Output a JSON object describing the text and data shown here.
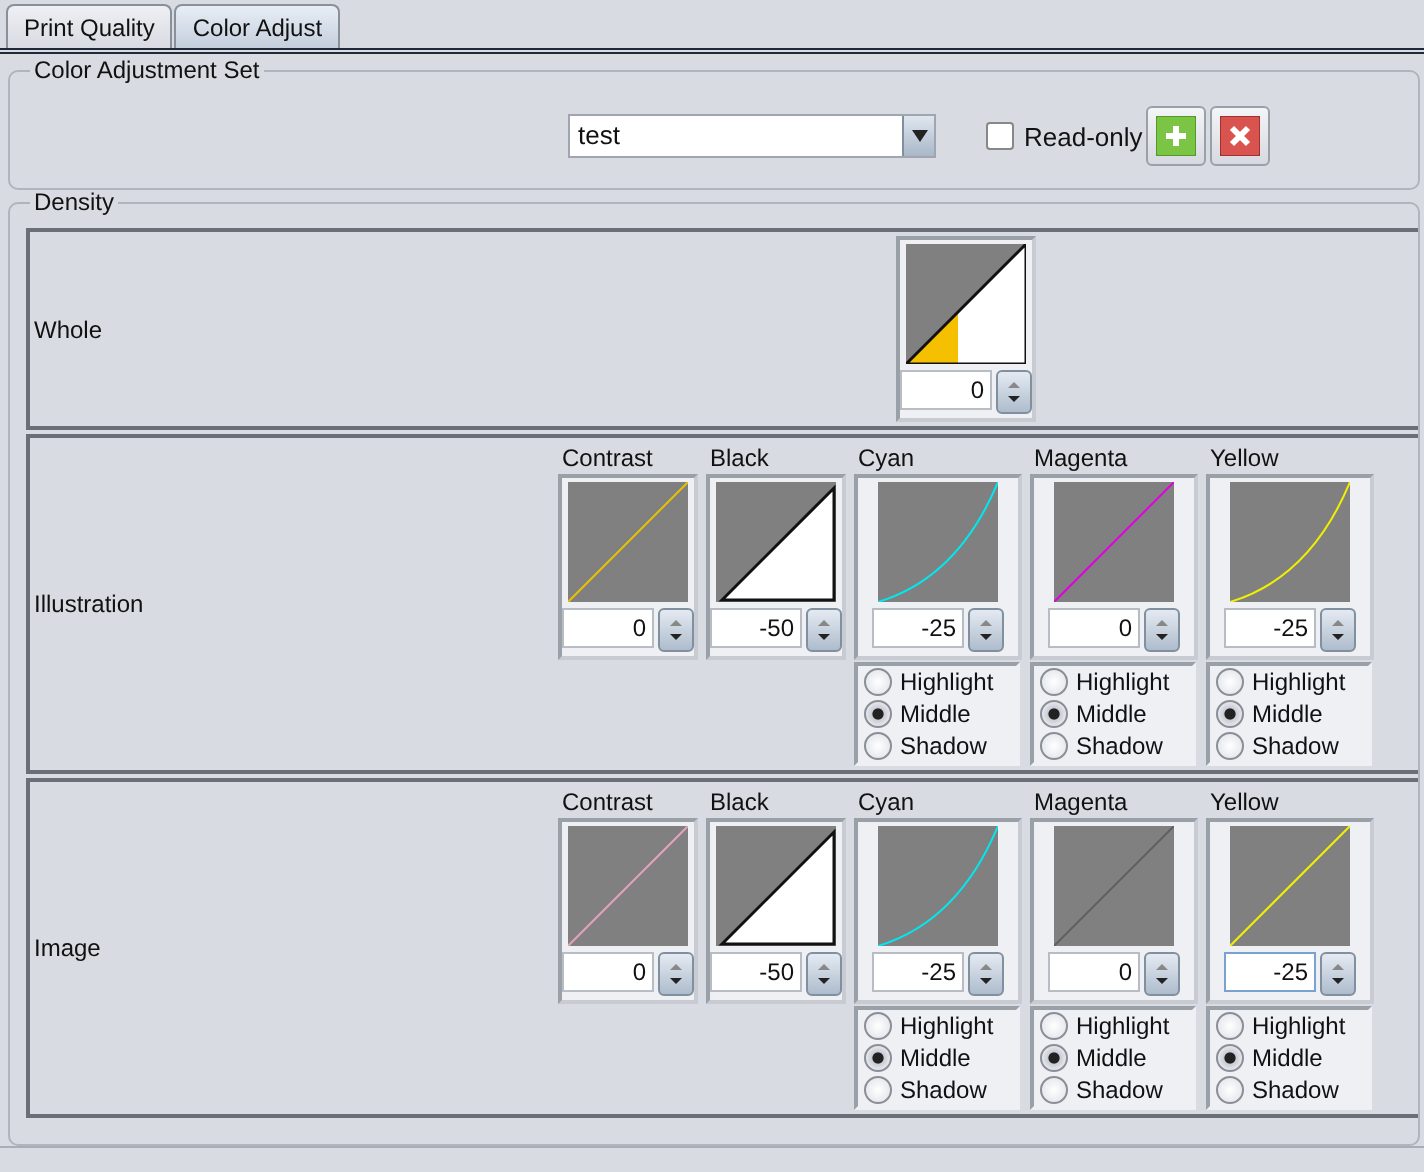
{
  "tabs": [
    {
      "label": "Print Quality",
      "selected": false
    },
    {
      "label": "Color Adjust",
      "selected": true
    }
  ],
  "adjustment_set": {
    "title": "Color Adjustment Set",
    "value": "test",
    "read_only": {
      "label": "Read-only",
      "checked": false
    }
  },
  "density": {
    "title": "Density",
    "rows": [
      {
        "label": "Whole",
        "channels": [
          {
            "kind": "whole",
            "value": "0",
            "focused": false
          }
        ]
      },
      {
        "label": "Illustration",
        "channels": [
          {
            "kind": "straight",
            "name": "Contrast",
            "color": "#e8c000",
            "value": "0",
            "focused": false
          },
          {
            "kind": "black",
            "name": "Black",
            "value": "-50",
            "focused": false
          },
          {
            "kind": "bent",
            "name": "Cyan",
            "color": "#00e8f0",
            "value": "-25",
            "focused": false,
            "tones": [
              {
                "label": "Highlight",
                "selected": false
              },
              {
                "label": "Middle",
                "selected": true
              },
              {
                "label": "Shadow",
                "selected": false
              }
            ]
          },
          {
            "kind": "straight",
            "name": "Magenta",
            "color": "#e000e0",
            "value": "0",
            "focused": false,
            "tones": [
              {
                "label": "Highlight",
                "selected": false
              },
              {
                "label": "Middle",
                "selected": true
              },
              {
                "label": "Shadow",
                "selected": false
              }
            ]
          },
          {
            "kind": "bent",
            "name": "Yellow",
            "color": "#f0f000",
            "value": "-25",
            "focused": false,
            "tones": [
              {
                "label": "Highlight",
                "selected": false
              },
              {
                "label": "Middle",
                "selected": true
              },
              {
                "label": "Shadow",
                "selected": false
              }
            ]
          }
        ]
      },
      {
        "label": "Image",
        "channels": [
          {
            "kind": "straight",
            "name": "Contrast",
            "color": "#e8a0c0",
            "value": "0",
            "focused": false
          },
          {
            "kind": "black",
            "name": "Black",
            "value": "-50",
            "focused": false
          },
          {
            "kind": "bent",
            "name": "Cyan",
            "color": "#00e8f0",
            "value": "-25",
            "focused": false,
            "tones": [
              {
                "label": "Highlight",
                "selected": false
              },
              {
                "label": "Middle",
                "selected": true
              },
              {
                "label": "Shadow",
                "selected": false
              }
            ]
          },
          {
            "kind": "straight",
            "name": "Magenta",
            "color": "#606060",
            "value": "0",
            "focused": false,
            "tones": [
              {
                "label": "Highlight",
                "selected": false
              },
              {
                "label": "Middle",
                "selected": true
              },
              {
                "label": "Shadow",
                "selected": false
              }
            ]
          },
          {
            "kind": "straight",
            "name": "Yellow",
            "color": "#f0f000",
            "value": "-25",
            "focused": true,
            "tones": [
              {
                "label": "Highlight",
                "selected": false
              },
              {
                "label": "Middle",
                "selected": true
              },
              {
                "label": "Shadow",
                "selected": false
              }
            ]
          }
        ]
      }
    ]
  }
}
